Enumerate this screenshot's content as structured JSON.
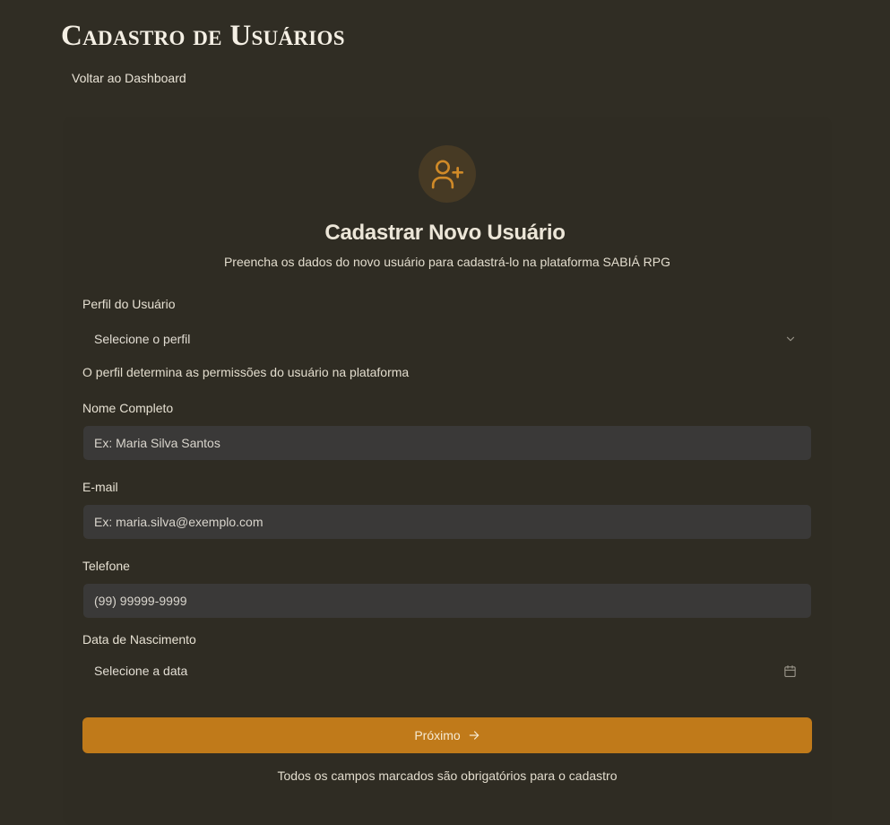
{
  "header": {
    "title": "Cadastro de Usuários",
    "back_link": "Voltar ao Dashboard"
  },
  "form": {
    "icon": "user-plus-icon",
    "heading": "Cadastrar Novo Usuário",
    "subtitle": "Preencha os dados do novo usuário para cadastrá-lo na plataforma SABIÁ RPG",
    "profile": {
      "label": "Perfil do Usuário",
      "selected": "Selecione o perfil",
      "helper": "O perfil determina as permissões do usuário na plataforma"
    },
    "name": {
      "label": "Nome Completo",
      "placeholder": "Ex: Maria Silva Santos"
    },
    "email": {
      "label": "E-mail",
      "placeholder": "Ex: maria.silva@exemplo.com"
    },
    "phone": {
      "label": "Telefone",
      "placeholder": "(99) 99999-9999"
    },
    "birthdate": {
      "label": "Data de Nascimento",
      "placeholder": "Selecione a data"
    },
    "next_button": "Próximo",
    "footnote": "Todos os campos marcados são obrigatórios para o cadastro"
  },
  "colors": {
    "background": "#302d24",
    "accent": "#c07a1a",
    "input_background": "#3a3938",
    "icon_circle": "#473a24"
  }
}
